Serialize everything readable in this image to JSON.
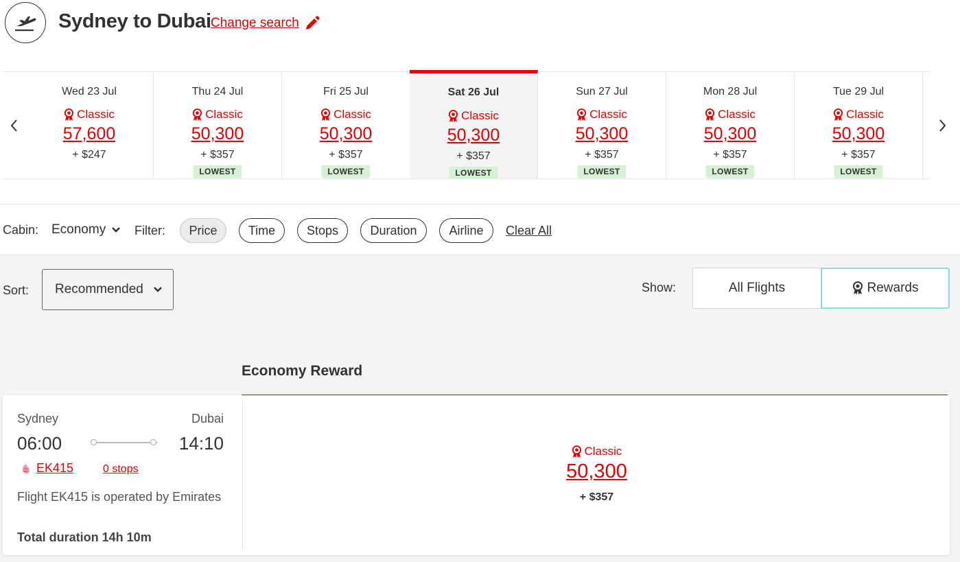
{
  "header": {
    "title": "Sydney to Dubai",
    "change_search": "Change search"
  },
  "date_strip": [
    {
      "date": "Wed 23 Jul",
      "fare_type": "Classic",
      "points": "57,600",
      "cash": "+ $247",
      "badge": ""
    },
    {
      "date": "Thu 24 Jul",
      "fare_type": "Classic",
      "points": "50,300",
      "cash": "+ $357",
      "badge": "LOWEST"
    },
    {
      "date": "Fri 25 Jul",
      "fare_type": "Classic",
      "points": "50,300",
      "cash": "+ $357",
      "badge": "LOWEST"
    },
    {
      "date": "Sat 26 Jul",
      "fare_type": "Classic",
      "points": "50,300",
      "cash": "+ $357",
      "badge": "LOWEST",
      "selected": true
    },
    {
      "date": "Sun 27 Jul",
      "fare_type": "Classic",
      "points": "50,300",
      "cash": "+ $357",
      "badge": "LOWEST"
    },
    {
      "date": "Mon 28 Jul",
      "fare_type": "Classic",
      "points": "50,300",
      "cash": "+ $357",
      "badge": "LOWEST"
    },
    {
      "date": "Tue 29 Jul",
      "fare_type": "Classic",
      "points": "50,300",
      "cash": "+ $357",
      "badge": "LOWEST"
    }
  ],
  "filters": {
    "cabin_label": "Cabin:",
    "cabin_value": "Economy",
    "filter_label": "Filter:",
    "chips": [
      "Price",
      "Time",
      "Stops",
      "Duration",
      "Airline"
    ],
    "clear_all": "Clear All"
  },
  "sort": {
    "label": "Sort:",
    "value": "Recommended"
  },
  "show": {
    "label": "Show:",
    "all_flights": "All Flights",
    "rewards": "Rewards"
  },
  "fare_heading": "Economy Reward",
  "flight": {
    "origin": "Sydney",
    "destination": "Dubai",
    "departure": "06:00",
    "arrival": "14:10",
    "flight_number": "EK415",
    "stops": "0 stops",
    "operated_by": "Flight EK415 is operated by Emirates",
    "duration": "Total duration 14h 10m",
    "fare": {
      "fare_type": "Classic",
      "points": "50,300",
      "cash": "+ $357"
    }
  },
  "colors": {
    "accent": "#e40000",
    "lowest_badge": "#d6f0d3",
    "rewards_border": "#8fdbd9",
    "grey_bg": "#f4f4f4"
  }
}
